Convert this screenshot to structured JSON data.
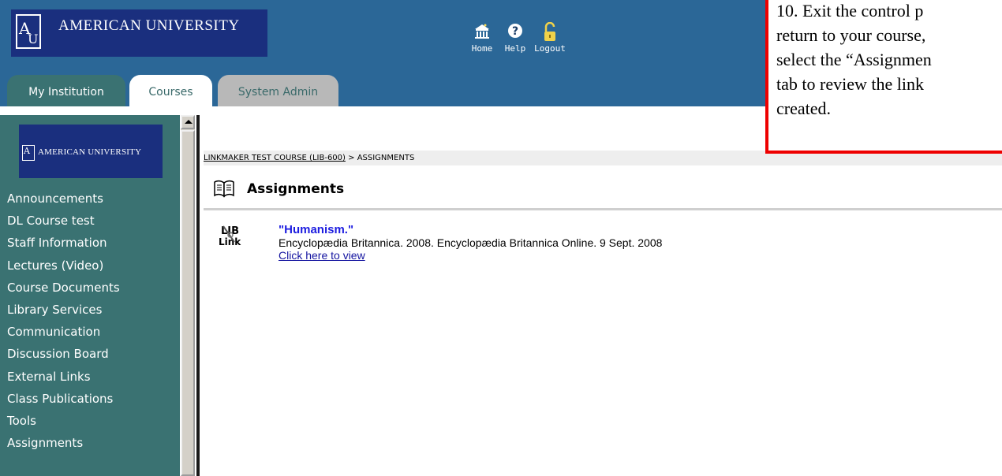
{
  "header": {
    "logo_text": "AMERICAN UNIVERSITY",
    "nav": {
      "home": "Home",
      "help": "Help",
      "logout": "Logout"
    }
  },
  "tabs": [
    {
      "label": "My Institution"
    },
    {
      "label": "Courses"
    },
    {
      "label": "System Admin"
    }
  ],
  "sidebar": {
    "logo_text": "AMERICAN UNIVERSITY",
    "items": [
      {
        "label": "Announcements"
      },
      {
        "label": "DL Course test"
      },
      {
        "label": "Staff Information"
      },
      {
        "label": "Lectures (Video)"
      },
      {
        "label": "Course Documents"
      },
      {
        "label": "Library Services"
      },
      {
        "label": "Communication"
      },
      {
        "label": "Discussion Board"
      },
      {
        "label": "External Links"
      },
      {
        "label": "Class Publications"
      },
      {
        "label": "Tools"
      },
      {
        "label": "Assignments"
      }
    ]
  },
  "breadcrumb": {
    "course": "LINKMAKER TEST COURSE (LIB-600)",
    "separator": " > ",
    "current": "ASSIGNMENTS"
  },
  "main": {
    "title": "Assignments",
    "item": {
      "icon_text_1": "LIB",
      "icon_text_2": "Link",
      "title": "\"Humanism.\"",
      "citation": "Encyclopædia Britannica. 2008. Encyclopædia Britannica Online. 9 Sept. 2008",
      "link": "Click here to view"
    }
  },
  "callout": {
    "lines": [
      "10. Exit the control p",
      "return to your course,",
      "select the “Assignmen",
      "tab to review the link",
      "created."
    ]
  },
  "colors": {
    "header_bg": "#2b6797",
    "logo_bg": "#1a2f7e",
    "sidebar_bg": "#3a7272",
    "callout_border": "#ee0000",
    "item_title": "#1c1ce0"
  }
}
